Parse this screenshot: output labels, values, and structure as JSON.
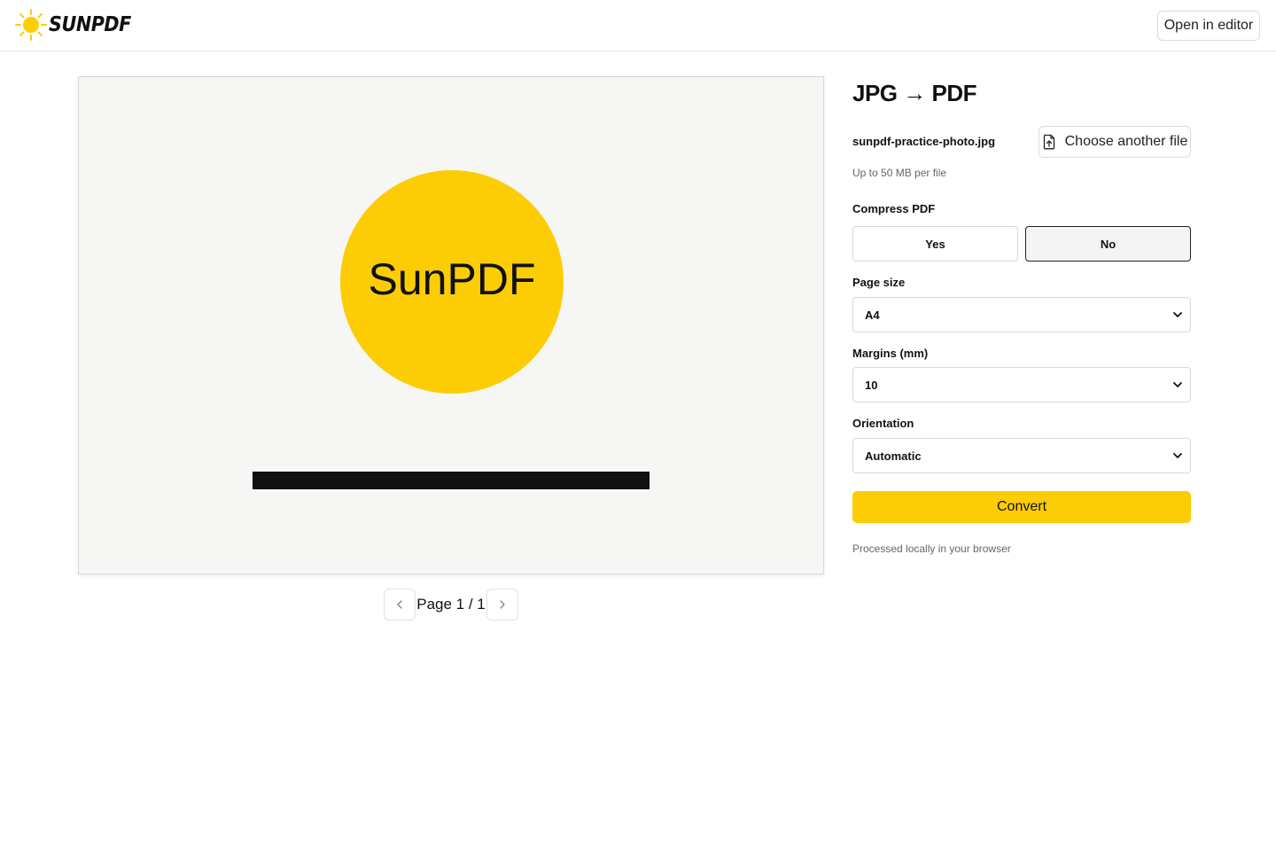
{
  "brand": {
    "name": "SUNPDF",
    "accent_color": "#fccd04"
  },
  "header": {
    "open_editor_label": "Open in editor"
  },
  "preview": {
    "image_text": "SunPDF",
    "circle_color": "#fccd04",
    "bar_color": "#111111",
    "background_color": "#f6f6f4"
  },
  "pager": {
    "label": "Page 1 / 1",
    "prev_icon": "chevron-left-icon",
    "next_icon": "chevron-right-icon"
  },
  "panel": {
    "title": "JPG → PDF",
    "filename": "sunpdf-practice-photo.jpg",
    "choose_label": "Choose another file",
    "choose_icon": "file-upload-icon",
    "hint": "Up to 50 MB per file",
    "compress": {
      "label": "Compress PDF",
      "yes": "Yes",
      "no": "No",
      "selected": "No"
    },
    "page_size": {
      "label": "Page size",
      "value": "A4"
    },
    "margins": {
      "label": "Margins (mm)",
      "value": "10"
    },
    "orientation": {
      "label": "Orientation",
      "value": "Automatic"
    },
    "convert_label": "Convert",
    "local_note": "Processed locally in your browser"
  }
}
